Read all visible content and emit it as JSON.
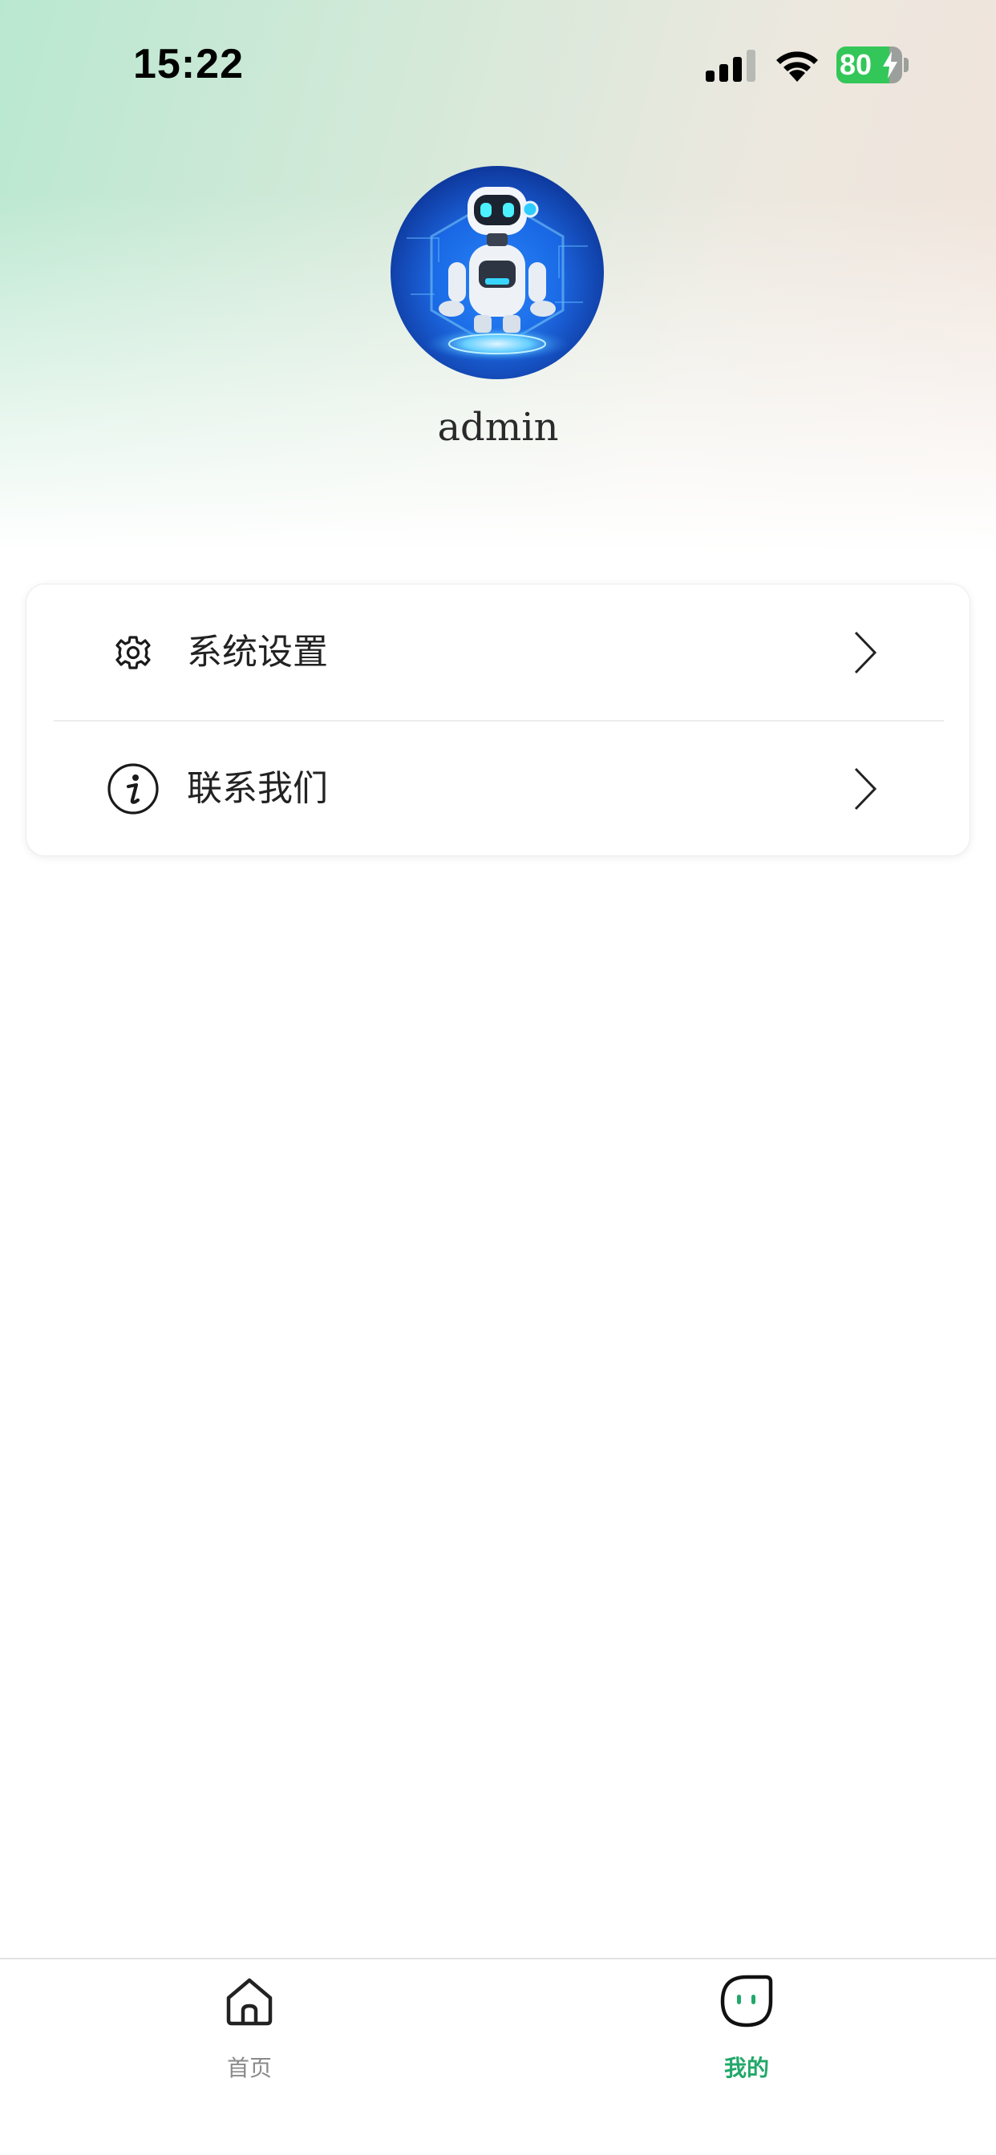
{
  "status_bar": {
    "time": "15:22",
    "battery_level": "80",
    "battery_fraction": 0.8,
    "charging": true
  },
  "profile": {
    "avatar_icon": "robot-avatar",
    "username": "admin"
  },
  "menu": {
    "items": [
      {
        "icon": "gear-icon",
        "label": "系统设置"
      },
      {
        "icon": "info-icon",
        "label": "联系我们"
      }
    ]
  },
  "tab_bar": {
    "active_color": "#22a86a",
    "inactive_color": "#8a8a8a",
    "tabs": [
      {
        "icon": "home-icon",
        "label": "首页",
        "active": false
      },
      {
        "icon": "mine-icon",
        "label": "我的",
        "active": true
      }
    ]
  }
}
